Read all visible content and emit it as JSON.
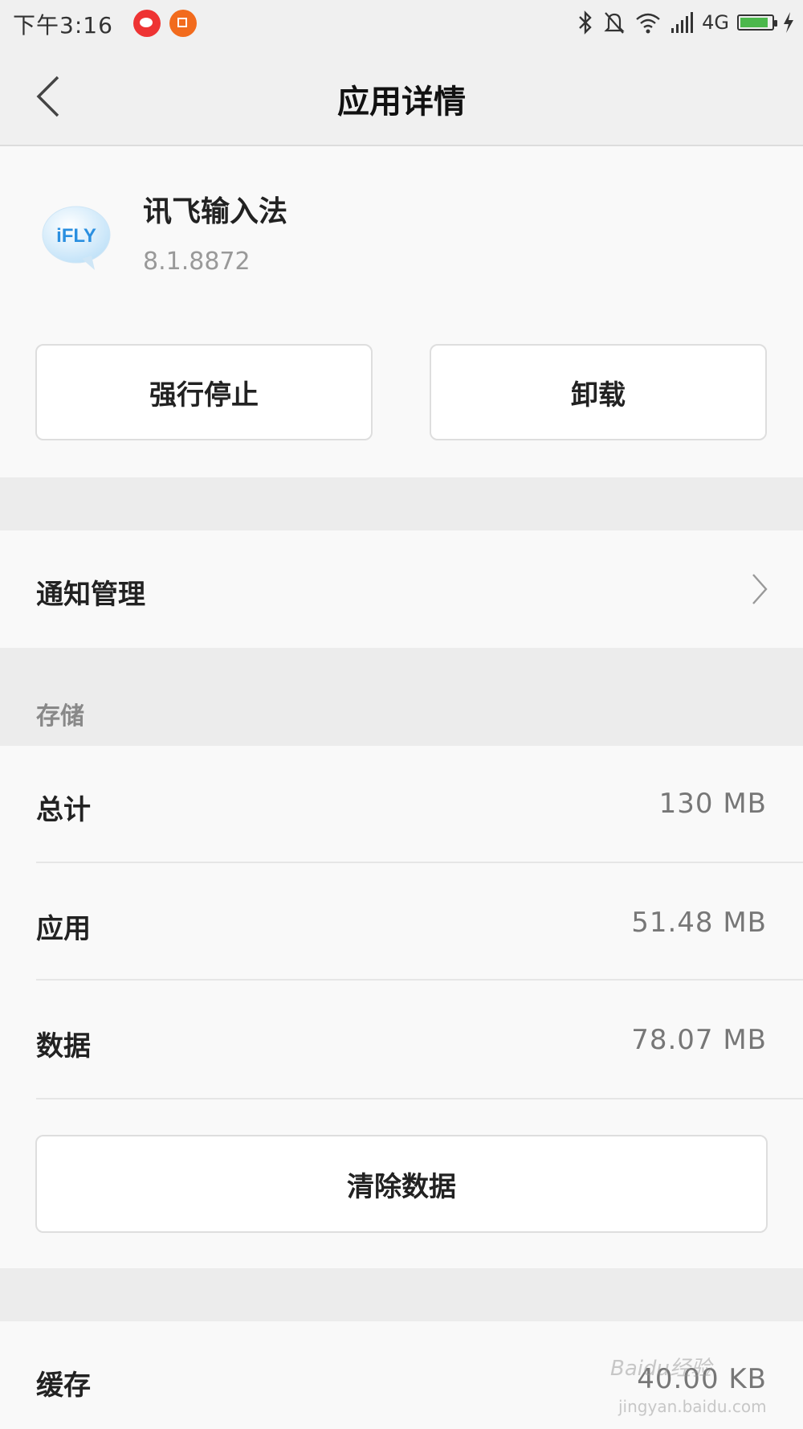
{
  "status_bar": {
    "time": "下午3:16",
    "network": "4G",
    "battery_level": 0.9,
    "battery_color": "#4cb84c"
  },
  "header": {
    "title": "应用详情",
    "back_icon": "chevron-left-icon"
  },
  "app": {
    "name": "讯飞输入法",
    "version": "8.1.8872",
    "icon_text": "iFLY",
    "icon_color": "#3aa0e8"
  },
  "actions": {
    "force_stop_label": "强行停止",
    "uninstall_label": "卸载"
  },
  "notification": {
    "label": "通知管理"
  },
  "storage": {
    "section_title": "存储",
    "total_label": "总计",
    "total_value": "130 MB",
    "app_label": "应用",
    "app_value": "51.48 MB",
    "data_label": "数据",
    "data_value": "78.07 MB",
    "clear_data_label": "清除数据"
  },
  "cache": {
    "label": "缓存",
    "value": "40.00 KB"
  },
  "watermark": {
    "text": "Baidu经验",
    "sub": "jingyan.baidu.com"
  }
}
